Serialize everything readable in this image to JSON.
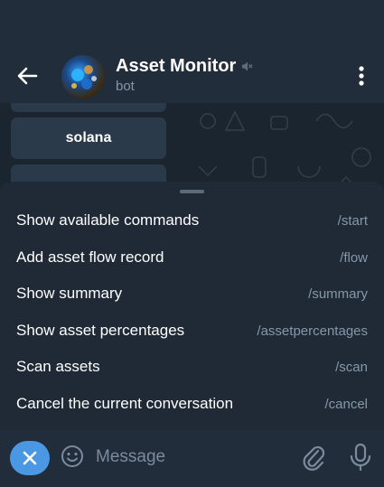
{
  "header": {
    "title": "Asset Monitor",
    "subtitle": "bot",
    "icons": [
      "back-arrow-icon",
      "muted-speaker-icon",
      "more-vertical-icon"
    ]
  },
  "chat": {
    "keyboard_buttons": [
      "",
      "solana",
      ""
    ]
  },
  "commands": [
    {
      "description": "Show available commands",
      "command": "/start"
    },
    {
      "description": "Add asset flow record",
      "command": "/flow"
    },
    {
      "description": "Show summary",
      "command": "/summary"
    },
    {
      "description": "Show asset percentages",
      "command": "/assetpercentages"
    },
    {
      "description": "Scan assets",
      "command": "/scan"
    },
    {
      "description": "Cancel the current conversation",
      "command": "/cancel"
    }
  ],
  "input": {
    "placeholder": "Message",
    "icons": [
      "close-icon",
      "emoji-icon",
      "attach-icon",
      "microphone-icon"
    ]
  },
  "colors": {
    "header_bg": "#212d3b",
    "sheet_bg": "#1f2a36",
    "accent": "#4a97e4",
    "muted_text": "#8797a7"
  }
}
